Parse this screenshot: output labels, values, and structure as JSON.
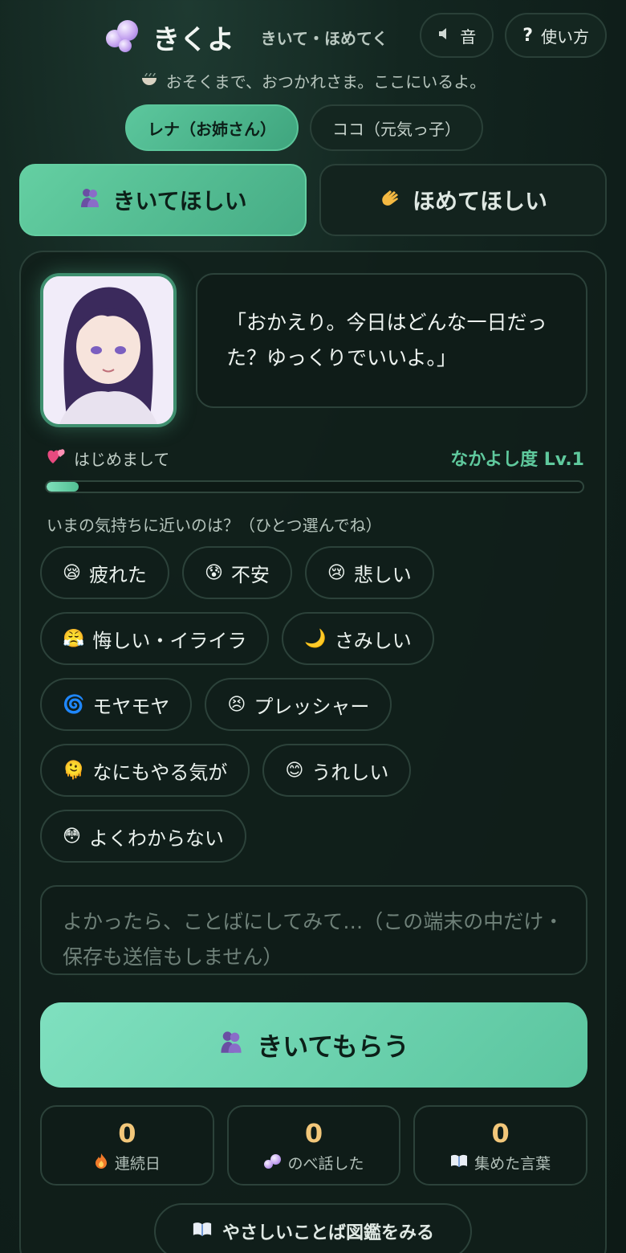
{
  "topbar": {
    "sound_label": "音",
    "sound_icon": "speaker-icon",
    "help_label": "使い方",
    "help_icon": "question-icon"
  },
  "brand": {
    "name": "きくよ",
    "subtitle": "きいて・ほめてく",
    "logo_icon": "bubbles-icon"
  },
  "tagline": {
    "icon": "bowl-icon",
    "text": "おそくまで、おつかれさま。ここにいるよ。"
  },
  "characters": [
    {
      "label": "レナ（お姉さん）",
      "active": true
    },
    {
      "label": "ココ（元気っ子）",
      "active": false
    }
  ],
  "modes": [
    {
      "label": "きいてほしい",
      "icon": "hug-icon",
      "active": true
    },
    {
      "label": "ほめてほしい",
      "icon": "clap-icon",
      "active": false
    }
  ],
  "speech": {
    "text": "「おかえり。今日はどんな一日だった？ゆっくりでいいよ。」"
  },
  "relationship": {
    "status": "はじめまして",
    "level_label": "なかよし度 Lv.1",
    "progress_percent": 6
  },
  "mood_prompt": "いまの気持ちに近いのは？（ひとつ選んでね）",
  "moods": [
    {
      "emoji": "😪",
      "label": "疲れた"
    },
    {
      "emoji": "😰",
      "label": "不安"
    },
    {
      "emoji": "😢",
      "label": "悲しい"
    },
    {
      "emoji": "😤",
      "label": "悔しい・イライラ"
    },
    {
      "emoji": "🌙",
      "label": "さみしい"
    },
    {
      "emoji": "🌀",
      "label": "モヤモヤ"
    },
    {
      "emoji": "😣",
      "label": "プレッシャー"
    },
    {
      "emoji": "🫠",
      "label": "なにもやる気が"
    },
    {
      "emoji": "😊",
      "label": "うれしい"
    },
    {
      "emoji": "😳",
      "label": "よくわからない"
    }
  ],
  "input": {
    "placeholder": "よかったら、ことばにしてみて…（この端末の中だけ・保存も送信もしません）"
  },
  "cta": {
    "label": "きいてもらう",
    "icon": "hug-icon"
  },
  "stats": [
    {
      "value": "0",
      "label": "連続日",
      "icon": "fire-icon"
    },
    {
      "value": "0",
      "label": "のべ話した",
      "icon": "bubbles-icon"
    },
    {
      "value": "0",
      "label": "集めた言葉",
      "icon": "book-icon"
    }
  ],
  "dex": {
    "label": "やさしいことば図鑑をみる",
    "icon": "book-icon"
  },
  "colors": {
    "accent": "#5cc79d",
    "gold": "#f2c77a",
    "background": "#0f1e1a"
  }
}
